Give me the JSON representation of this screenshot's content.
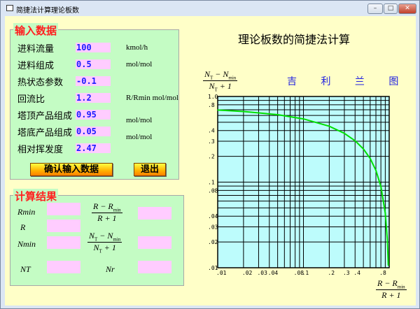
{
  "window": {
    "title": "简捷法计算理论板数",
    "buttons": [
      "minimize",
      "maximize",
      "close"
    ]
  },
  "main_title": "理论板数的简捷法计算",
  "input": {
    "title": "输入数据",
    "fields": [
      {
        "label": "进料流量",
        "value": "100",
        "unit": "kmol/h"
      },
      {
        "label": "进料组成",
        "value": "0.5",
        "unit": "mol/mol"
      },
      {
        "label": "热状态参数",
        "value": "-0.1",
        "unit": ""
      },
      {
        "label": "回流比",
        "value": "1.2",
        "unit": "R/Rmin mol/mol"
      },
      {
        "label": "塔顶产品组成",
        "value": "0.95",
        "unit": "mol/mol"
      },
      {
        "label": "塔底产品组成",
        "value": "0.05",
        "unit": "mol/mol"
      },
      {
        "label": "相对挥发度",
        "value": "2.47",
        "unit": ""
      }
    ],
    "confirm_label": "确认输入数据",
    "exit_label": "退出"
  },
  "results": {
    "title": "计算结果",
    "fields": [
      {
        "label": "Rmin",
        "value": ""
      },
      {
        "label": "R",
        "value": ""
      },
      {
        "label": "Nmin",
        "value": ""
      },
      {
        "label": "NT",
        "value": ""
      },
      {
        "label": "(R-Rmin)/(R+1)",
        "value": ""
      },
      {
        "label": "(NT-Nmin)/(NT+1)",
        "value": ""
      },
      {
        "label": "Nr",
        "value": ""
      }
    ]
  },
  "chart_data": {
    "type": "line",
    "title": "吉 利 兰 图",
    "xlabel": "(R - Rmin)/(R + 1)",
    "ylabel": "(NT - Nmin)/(NT + 1)",
    "xscale": "log",
    "yscale": "log",
    "xlim": [
      0.01,
      1
    ],
    "ylim": [
      0.01,
      1
    ],
    "grid": true,
    "xticks": [
      ".01",
      ".02",
      ".03",
      ".04",
      ".08",
      ".1",
      ".2",
      ".3",
      ".4",
      ".8"
    ],
    "xtick_values": [
      0.01,
      0.02,
      0.03,
      0.04,
      0.08,
      0.1,
      0.2,
      0.3,
      0.4,
      0.8
    ],
    "yticks": [
      "1.0",
      ".8",
      ".4",
      ".3",
      ".2",
      ".1",
      ".08",
      ".04",
      ".03",
      ".02",
      ".01"
    ],
    "ytick_values": [
      1,
      0.8,
      0.4,
      0.3,
      0.2,
      0.1,
      0.08,
      0.04,
      0.03,
      0.02,
      0.01
    ],
    "series": [
      {
        "color": "#00e000",
        "x": [
          0.01,
          0.02,
          0.05,
          0.1,
          0.2,
          0.3,
          0.4,
          0.5,
          0.6,
          0.7,
          0.8,
          0.9,
          0.95,
          0.97,
          0.975
        ],
        "y": [
          0.695,
          0.668,
          0.613,
          0.547,
          0.449,
          0.371,
          0.304,
          0.244,
          0.189,
          0.137,
          0.089,
          0.0435,
          0.0215,
          0.0128,
          0.0107
        ]
      }
    ],
    "plot_bg": "#bdfcfc"
  }
}
